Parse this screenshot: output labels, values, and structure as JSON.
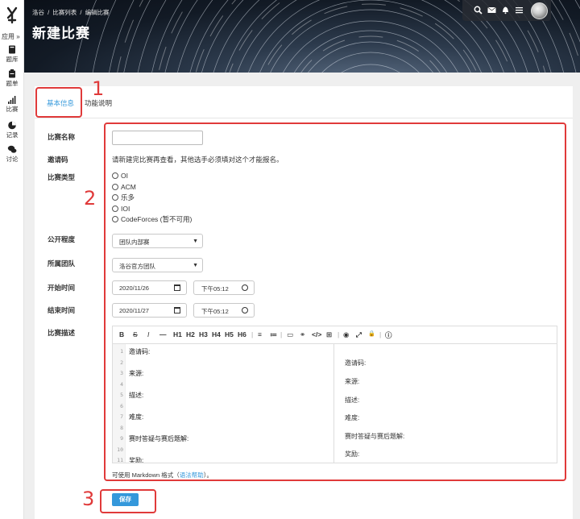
{
  "sidebar": {
    "apps_label": "应用 »",
    "items": [
      {
        "label": "题库",
        "icon": "book-icon"
      },
      {
        "label": "题单",
        "icon": "clipboard-icon"
      },
      {
        "label": "比赛",
        "icon": "signal-bars-icon"
      },
      {
        "label": "记录",
        "icon": "pie-chart-icon"
      },
      {
        "label": "讨论",
        "icon": "chat-bubbles-icon"
      }
    ]
  },
  "breadcrumb": [
    "洛谷",
    "/",
    "比赛列表",
    "/",
    "编辑比赛"
  ],
  "page_title": "新建比赛",
  "topbar_icons": [
    "search-icon",
    "mail-icon",
    "bell-icon",
    "list-icon"
  ],
  "tabs": [
    "基本信息",
    "功能说明"
  ],
  "form": {
    "name_label": "比赛名称",
    "name_value": "",
    "invite_label": "邀请码",
    "invite_text": "请新建完比赛再查看，其他选手必须填对这个才能报名。",
    "type_label": "比赛类型",
    "type_options": [
      "OI",
      "ACM",
      "乐多",
      "IOI",
      "CodeForces (暂不可用)"
    ],
    "visibility_label": "公开程度",
    "visibility_value": "团队内部赛",
    "team_label": "所属团队",
    "team_value": "洛谷官方团队",
    "start_label": "开始时间",
    "start_date": "2020/11/26",
    "start_time": "下午05:12",
    "end_label": "结束时间",
    "end_date": "2020/11/27",
    "end_time": "下午05:12",
    "desc_label": "比赛描述"
  },
  "editor": {
    "toolbar": [
      "B",
      "S",
      "I",
      "—",
      "H1",
      "H2",
      "H3",
      "H4",
      "H5",
      "H6",
      "|",
      "≡",
      "≔",
      "|",
      "▭",
      "⚭",
      "</>",
      "⊞",
      "|",
      "◉",
      "⤢",
      "🔒",
      "|",
      "ⓘ"
    ],
    "line_numbers": [
      "1",
      "2",
      "3",
      "4",
      "5",
      "6",
      "7",
      "8",
      "9",
      "10",
      "11"
    ],
    "code_lines": [
      "邀请码:",
      "",
      "来源:",
      "",
      "描述:",
      "",
      "难度:",
      "",
      "赛时答疑与赛后题解:",
      "",
      "奖励:"
    ],
    "preview_lines": [
      "邀请码:",
      "来源:",
      "描述:",
      "难度:",
      "赛时答疑与赛后题解:",
      "奖励:"
    ]
  },
  "markdown_note_prefix": "可使用 Markdown 格式（",
  "markdown_note_link": "语法帮助",
  "markdown_note_suffix": "）。",
  "save_label": "保存",
  "annotations": [
    "1",
    "2",
    "3"
  ],
  "colors": {
    "accent": "#3498db",
    "annotation": "#e03a3a"
  }
}
